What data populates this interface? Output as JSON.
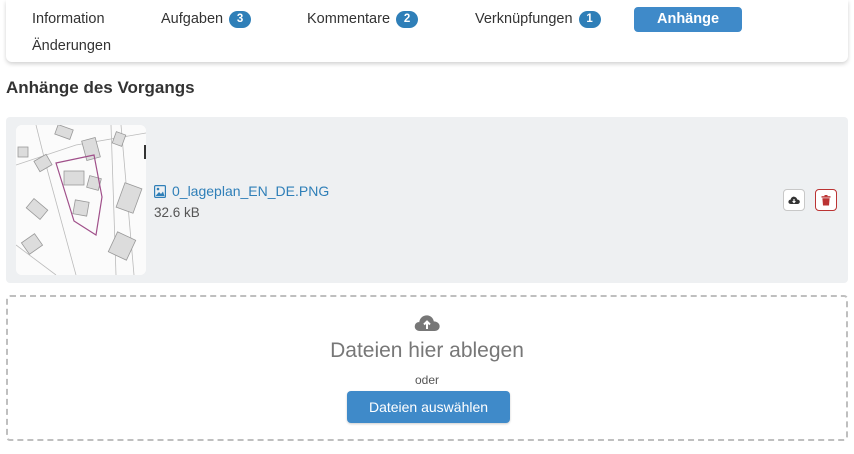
{
  "tabs": {
    "information": {
      "label": "Information"
    },
    "aufgaben": {
      "label": "Aufgaben",
      "count": "3"
    },
    "kommentare": {
      "label": "Kommentare",
      "count": "2"
    },
    "verknuepfungen": {
      "label": "Verknüpfungen",
      "count": "1"
    },
    "anhaenge": {
      "label": "Anhänge",
      "active": true
    },
    "aenderungen": {
      "label": "Änderungen"
    }
  },
  "section": {
    "title": "Anhänge des Vorgangs"
  },
  "attachments": [
    {
      "file_name": "0_lageplan_EN_DE.PNG",
      "size": "32.6 kB",
      "icon": "image-file-icon",
      "actions": [
        "download-cloud-icon",
        "trash-icon"
      ]
    }
  ],
  "dropzone": {
    "icon": "cloud-upload-icon",
    "title": "Dateien hier ablegen",
    "or_text": "oder",
    "button_label": "Dateien auswählen"
  },
  "colors": {
    "primary": "#3f8ac9",
    "badge": "#2f7fb8",
    "danger": "#b33333",
    "row_bg": "#eef0f2"
  }
}
